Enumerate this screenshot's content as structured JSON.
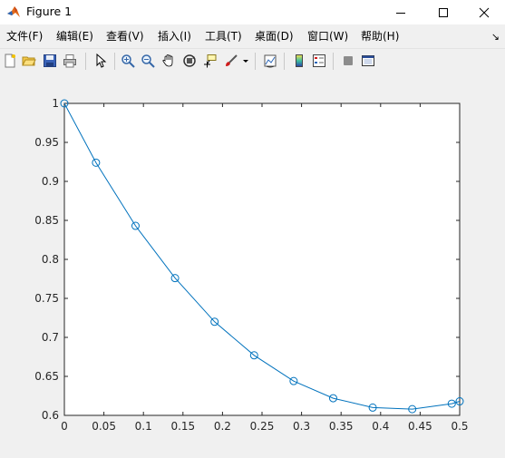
{
  "window": {
    "title": "Figure 1"
  },
  "menu": [
    "文件(F)",
    "编辑(E)",
    "查看(V)",
    "插入(I)",
    "工具(T)",
    "桌面(D)",
    "窗口(W)",
    "帮助(H)"
  ],
  "toolbar": {
    "icons": [
      "new-figure-icon",
      "open-file-icon",
      "save-icon",
      "print-icon",
      "edit-plot-icon",
      "zoom-in-icon",
      "zoom-out-icon",
      "pan-icon",
      "rotate-3d-icon",
      "data-cursor-icon",
      "brush-icon",
      "brush-dropdown-icon",
      "link-plot-icon",
      "colorbar-icon",
      "legend-icon",
      "hide-plot-tools-icon",
      "show-plot-tools-icon"
    ]
  },
  "colors": {
    "line": "#0072BD",
    "axes_bg": "#ffffff",
    "figure_bg": "#f0f0f0"
  },
  "chart_data": {
    "type": "line",
    "marker": "circle",
    "xlim": [
      0,
      0.5
    ],
    "ylim": [
      0.6,
      1
    ],
    "xticks": [
      0,
      0.05,
      0.1,
      0.15,
      0.2,
      0.25,
      0.3,
      0.35,
      0.4,
      0.45,
      0.5
    ],
    "xtick_labels": [
      "0",
      "0.05",
      "0.1",
      "0.15",
      "0.2",
      "0.25",
      "0.3",
      "0.35",
      "0.4",
      "0.45",
      "0.5"
    ],
    "yticks": [
      0.6,
      0.65,
      0.7,
      0.75,
      0.8,
      0.85,
      0.9,
      0.95,
      1
    ],
    "ytick_labels": [
      "0.6",
      "0.65",
      "0.7",
      "0.75",
      "0.8",
      "0.85",
      "0.9",
      "0.95",
      "1"
    ],
    "grid": false,
    "x": [
      0,
      0.04,
      0.09,
      0.14,
      0.19,
      0.24,
      0.29,
      0.34,
      0.39,
      0.44,
      0.49,
      0.5
    ],
    "y": [
      1.0,
      0.924,
      0.843,
      0.776,
      0.72,
      0.677,
      0.644,
      0.622,
      0.61,
      0.608,
      0.615,
      0.618
    ]
  }
}
